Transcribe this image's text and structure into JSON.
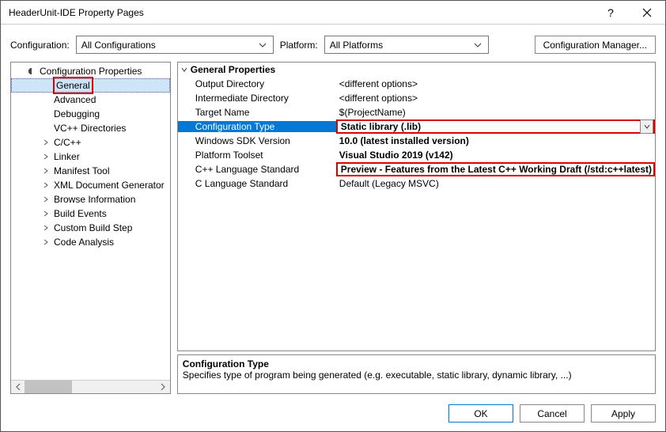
{
  "window": {
    "title": "HeaderUnit-IDE Property Pages"
  },
  "toolbar": {
    "config_label": "Configuration:",
    "config_value": "All Configurations",
    "platform_label": "Platform:",
    "platform_value": "All Platforms",
    "config_manager": "Configuration Manager..."
  },
  "tree": {
    "root": "Configuration Properties",
    "items": [
      {
        "label": "General",
        "hasCaret": false,
        "highlight": true,
        "sel": true
      },
      {
        "label": "Advanced",
        "hasCaret": false
      },
      {
        "label": "Debugging",
        "hasCaret": false
      },
      {
        "label": "VC++ Directories",
        "hasCaret": false
      },
      {
        "label": "C/C++",
        "hasCaret": true
      },
      {
        "label": "Linker",
        "hasCaret": true
      },
      {
        "label": "Manifest Tool",
        "hasCaret": true
      },
      {
        "label": "XML Document Generator",
        "hasCaret": true
      },
      {
        "label": "Browse Information",
        "hasCaret": true
      },
      {
        "label": "Build Events",
        "hasCaret": true
      },
      {
        "label": "Custom Build Step",
        "hasCaret": true
      },
      {
        "label": "Code Analysis",
        "hasCaret": true
      }
    ]
  },
  "props": {
    "header": "General Properties",
    "rows": [
      {
        "name": "Output Directory",
        "value": "<different options>"
      },
      {
        "name": "Intermediate Directory",
        "value": "<different options>"
      },
      {
        "name": "Target Name",
        "value": "$(ProjectName)"
      },
      {
        "name": "Configuration Type",
        "value": "Static library (.lib)",
        "sel": true,
        "red": true
      },
      {
        "name": "Windows SDK Version",
        "value": "10.0 (latest installed version)",
        "bold": true
      },
      {
        "name": "Platform Toolset",
        "value": "Visual Studio 2019 (v142)",
        "bold": true
      },
      {
        "name": "C++ Language Standard",
        "value": "Preview - Features from the Latest C++ Working Draft (/std:c++latest)",
        "red": true
      },
      {
        "name": "C Language Standard",
        "value": "Default (Legacy MSVC)"
      }
    ]
  },
  "desc": {
    "title": "Configuration Type",
    "text": "Specifies type of program being generated (e.g. executable, static library, dynamic library, ...)"
  },
  "footer": {
    "ok": "OK",
    "cancel": "Cancel",
    "apply": "Apply"
  }
}
